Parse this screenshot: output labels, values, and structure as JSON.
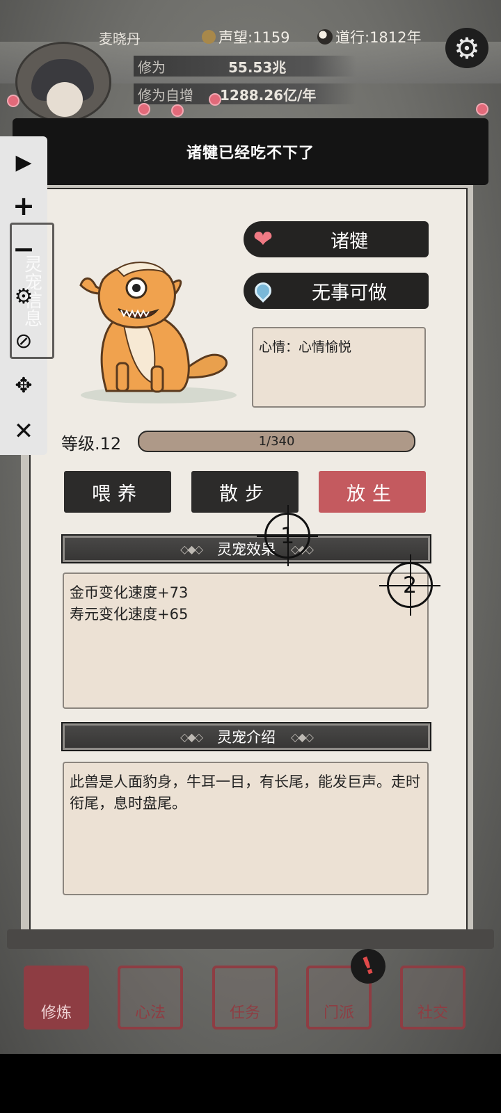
{
  "header": {
    "player_name": "麦晓丹",
    "fame": "声望:1159",
    "dao": "道行:1812年",
    "cultivation_label": "修为",
    "cultivation_value": "55.53兆",
    "gain_label": "修为自增",
    "gain_value": "1288.26亿/年"
  },
  "banner": {
    "message": "诸犍已经吃不下了"
  },
  "pet": {
    "name": "诸犍",
    "status": "无事可做",
    "mood": "心情：心情愉悦",
    "level": "等级.12",
    "xp_text": "1/340",
    "xp_fraction": 0.003
  },
  "actions": {
    "feed": "喂养",
    "walk": "散步",
    "release": "放生"
  },
  "effects": {
    "header": "灵宠效果",
    "lines": [
      "金币变化速度+73",
      "寿元变化速度+65"
    ]
  },
  "intro": {
    "header": "灵宠介绍",
    "text": "此兽是人面豹身，牛耳一目，有长尾，能发巨声。走时衔尾，息时盘尾。"
  },
  "side_tab": "灵宠信息",
  "markers": [
    "1",
    "2"
  ],
  "nav": [
    "修炼",
    "心法",
    "任务",
    "门派",
    "社交"
  ],
  "alert": "!",
  "colors": {
    "release": "#c45a5f",
    "seal": "#8e3d43",
    "heart": "#f07a84"
  }
}
